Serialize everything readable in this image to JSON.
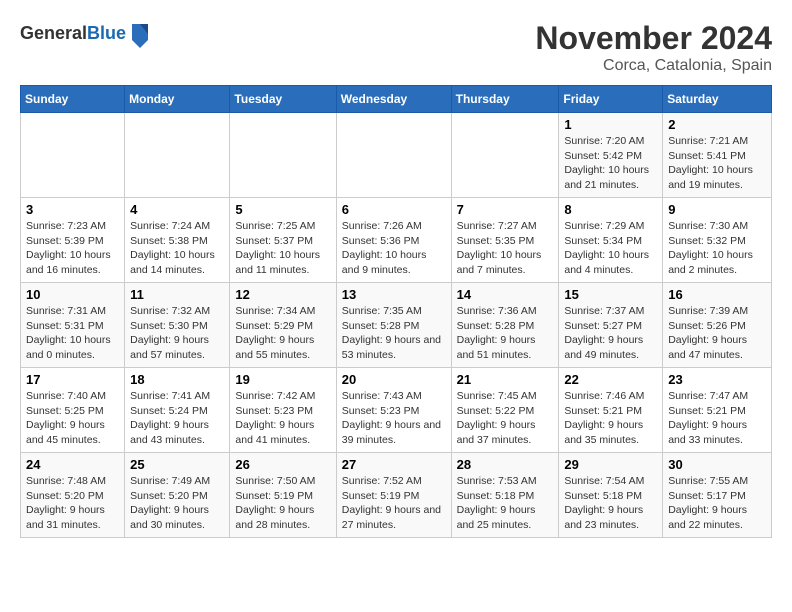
{
  "header": {
    "logo_line1": "General",
    "logo_line2": "Blue",
    "month": "November 2024",
    "location": "Corca, Catalonia, Spain"
  },
  "weekdays": [
    "Sunday",
    "Monday",
    "Tuesday",
    "Wednesday",
    "Thursday",
    "Friday",
    "Saturday"
  ],
  "weeks": [
    [
      {
        "day": "",
        "sunrise": "",
        "sunset": "",
        "daylight": ""
      },
      {
        "day": "",
        "sunrise": "",
        "sunset": "",
        "daylight": ""
      },
      {
        "day": "",
        "sunrise": "",
        "sunset": "",
        "daylight": ""
      },
      {
        "day": "",
        "sunrise": "",
        "sunset": "",
        "daylight": ""
      },
      {
        "day": "",
        "sunrise": "",
        "sunset": "",
        "daylight": ""
      },
      {
        "day": "1",
        "sunrise": "Sunrise: 7:20 AM",
        "sunset": "Sunset: 5:42 PM",
        "daylight": "Daylight: 10 hours and 21 minutes."
      },
      {
        "day": "2",
        "sunrise": "Sunrise: 7:21 AM",
        "sunset": "Sunset: 5:41 PM",
        "daylight": "Daylight: 10 hours and 19 minutes."
      }
    ],
    [
      {
        "day": "3",
        "sunrise": "Sunrise: 7:23 AM",
        "sunset": "Sunset: 5:39 PM",
        "daylight": "Daylight: 10 hours and 16 minutes."
      },
      {
        "day": "4",
        "sunrise": "Sunrise: 7:24 AM",
        "sunset": "Sunset: 5:38 PM",
        "daylight": "Daylight: 10 hours and 14 minutes."
      },
      {
        "day": "5",
        "sunrise": "Sunrise: 7:25 AM",
        "sunset": "Sunset: 5:37 PM",
        "daylight": "Daylight: 10 hours and 11 minutes."
      },
      {
        "day": "6",
        "sunrise": "Sunrise: 7:26 AM",
        "sunset": "Sunset: 5:36 PM",
        "daylight": "Daylight: 10 hours and 9 minutes."
      },
      {
        "day": "7",
        "sunrise": "Sunrise: 7:27 AM",
        "sunset": "Sunset: 5:35 PM",
        "daylight": "Daylight: 10 hours and 7 minutes."
      },
      {
        "day": "8",
        "sunrise": "Sunrise: 7:29 AM",
        "sunset": "Sunset: 5:34 PM",
        "daylight": "Daylight: 10 hours and 4 minutes."
      },
      {
        "day": "9",
        "sunrise": "Sunrise: 7:30 AM",
        "sunset": "Sunset: 5:32 PM",
        "daylight": "Daylight: 10 hours and 2 minutes."
      }
    ],
    [
      {
        "day": "10",
        "sunrise": "Sunrise: 7:31 AM",
        "sunset": "Sunset: 5:31 PM",
        "daylight": "Daylight: 10 hours and 0 minutes."
      },
      {
        "day": "11",
        "sunrise": "Sunrise: 7:32 AM",
        "sunset": "Sunset: 5:30 PM",
        "daylight": "Daylight: 9 hours and 57 minutes."
      },
      {
        "day": "12",
        "sunrise": "Sunrise: 7:34 AM",
        "sunset": "Sunset: 5:29 PM",
        "daylight": "Daylight: 9 hours and 55 minutes."
      },
      {
        "day": "13",
        "sunrise": "Sunrise: 7:35 AM",
        "sunset": "Sunset: 5:28 PM",
        "daylight": "Daylight: 9 hours and 53 minutes."
      },
      {
        "day": "14",
        "sunrise": "Sunrise: 7:36 AM",
        "sunset": "Sunset: 5:28 PM",
        "daylight": "Daylight: 9 hours and 51 minutes."
      },
      {
        "day": "15",
        "sunrise": "Sunrise: 7:37 AM",
        "sunset": "Sunset: 5:27 PM",
        "daylight": "Daylight: 9 hours and 49 minutes."
      },
      {
        "day": "16",
        "sunrise": "Sunrise: 7:39 AM",
        "sunset": "Sunset: 5:26 PM",
        "daylight": "Daylight: 9 hours and 47 minutes."
      }
    ],
    [
      {
        "day": "17",
        "sunrise": "Sunrise: 7:40 AM",
        "sunset": "Sunset: 5:25 PM",
        "daylight": "Daylight: 9 hours and 45 minutes."
      },
      {
        "day": "18",
        "sunrise": "Sunrise: 7:41 AM",
        "sunset": "Sunset: 5:24 PM",
        "daylight": "Daylight: 9 hours and 43 minutes."
      },
      {
        "day": "19",
        "sunrise": "Sunrise: 7:42 AM",
        "sunset": "Sunset: 5:23 PM",
        "daylight": "Daylight: 9 hours and 41 minutes."
      },
      {
        "day": "20",
        "sunrise": "Sunrise: 7:43 AM",
        "sunset": "Sunset: 5:23 PM",
        "daylight": "Daylight: 9 hours and 39 minutes."
      },
      {
        "day": "21",
        "sunrise": "Sunrise: 7:45 AM",
        "sunset": "Sunset: 5:22 PM",
        "daylight": "Daylight: 9 hours and 37 minutes."
      },
      {
        "day": "22",
        "sunrise": "Sunrise: 7:46 AM",
        "sunset": "Sunset: 5:21 PM",
        "daylight": "Daylight: 9 hours and 35 minutes."
      },
      {
        "day": "23",
        "sunrise": "Sunrise: 7:47 AM",
        "sunset": "Sunset: 5:21 PM",
        "daylight": "Daylight: 9 hours and 33 minutes."
      }
    ],
    [
      {
        "day": "24",
        "sunrise": "Sunrise: 7:48 AM",
        "sunset": "Sunset: 5:20 PM",
        "daylight": "Daylight: 9 hours and 31 minutes."
      },
      {
        "day": "25",
        "sunrise": "Sunrise: 7:49 AM",
        "sunset": "Sunset: 5:20 PM",
        "daylight": "Daylight: 9 hours and 30 minutes."
      },
      {
        "day": "26",
        "sunrise": "Sunrise: 7:50 AM",
        "sunset": "Sunset: 5:19 PM",
        "daylight": "Daylight: 9 hours and 28 minutes."
      },
      {
        "day": "27",
        "sunrise": "Sunrise: 7:52 AM",
        "sunset": "Sunset: 5:19 PM",
        "daylight": "Daylight: 9 hours and 27 minutes."
      },
      {
        "day": "28",
        "sunrise": "Sunrise: 7:53 AM",
        "sunset": "Sunset: 5:18 PM",
        "daylight": "Daylight: 9 hours and 25 minutes."
      },
      {
        "day": "29",
        "sunrise": "Sunrise: 7:54 AM",
        "sunset": "Sunset: 5:18 PM",
        "daylight": "Daylight: 9 hours and 23 minutes."
      },
      {
        "day": "30",
        "sunrise": "Sunrise: 7:55 AM",
        "sunset": "Sunset: 5:17 PM",
        "daylight": "Daylight: 9 hours and 22 minutes."
      }
    ]
  ]
}
